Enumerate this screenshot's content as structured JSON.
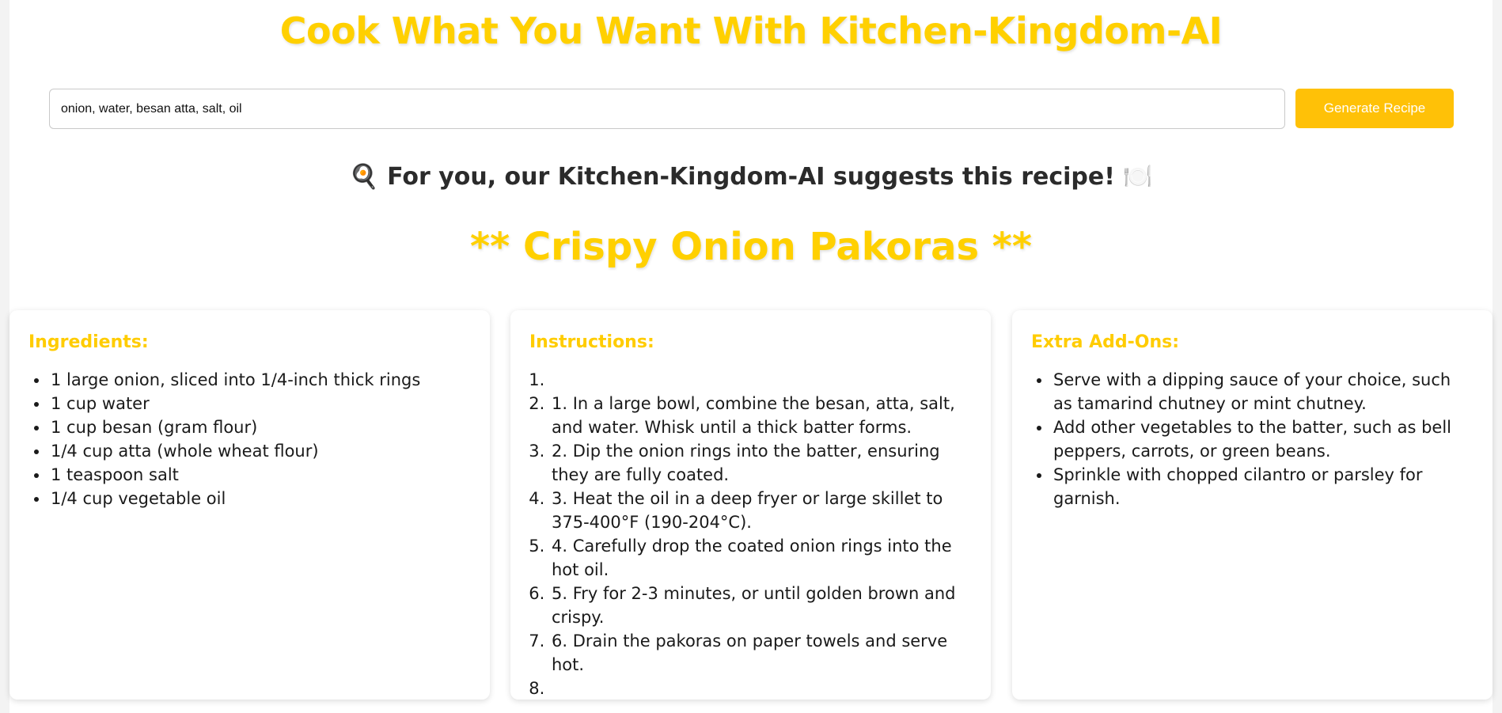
{
  "header": {
    "title": "Cook What You Want With Kitchen-Kingdom-AI"
  },
  "search": {
    "value": "onion, water, besan atta, salt, oil",
    "button_label": "Generate Recipe"
  },
  "suggestion": {
    "left_emoji": "🍳",
    "text": "For you, our Kitchen-Kingdom-AI suggests this recipe!",
    "right_emoji": "🍽️"
  },
  "recipe": {
    "title": "** Crispy Onion Pakoras **",
    "ingredients": {
      "heading": "Ingredients:",
      "items": [
        "1 large onion, sliced into 1/4-inch thick rings",
        "1 cup water",
        "1 cup besan (gram flour)",
        "1/4 cup atta (whole wheat flour)",
        "1 teaspoon salt",
        "1/4 cup vegetable oil"
      ]
    },
    "instructions": {
      "heading": "Instructions:",
      "items": [
        "",
        "1. In a large bowl, combine the besan, atta, salt, and water. Whisk until a thick batter forms.",
        "2. Dip the onion rings into the batter, ensuring they are fully coated.",
        "3. Heat the oil in a deep fryer or large skillet to 375-400°F (190-204°C).",
        "4. Carefully drop the coated onion rings into the hot oil.",
        "5. Fry for 2-3 minutes, or until golden brown and crispy.",
        "6. Drain the pakoras on paper towels and serve hot.",
        ""
      ]
    },
    "addons": {
      "heading": "Extra Add-Ons:",
      "items": [
        "Serve with a dipping sauce of your choice, such as tamarind chutney or mint chutney.",
        "Add other vegetables to the batter, such as bell peppers, carrots, or green beans.",
        "Sprinkle with chopped cilantro or parsley for garnish."
      ]
    }
  },
  "colors": {
    "accent": "#ffd000",
    "button": "#ffc107",
    "heading_dark": "#2b2b2b"
  }
}
